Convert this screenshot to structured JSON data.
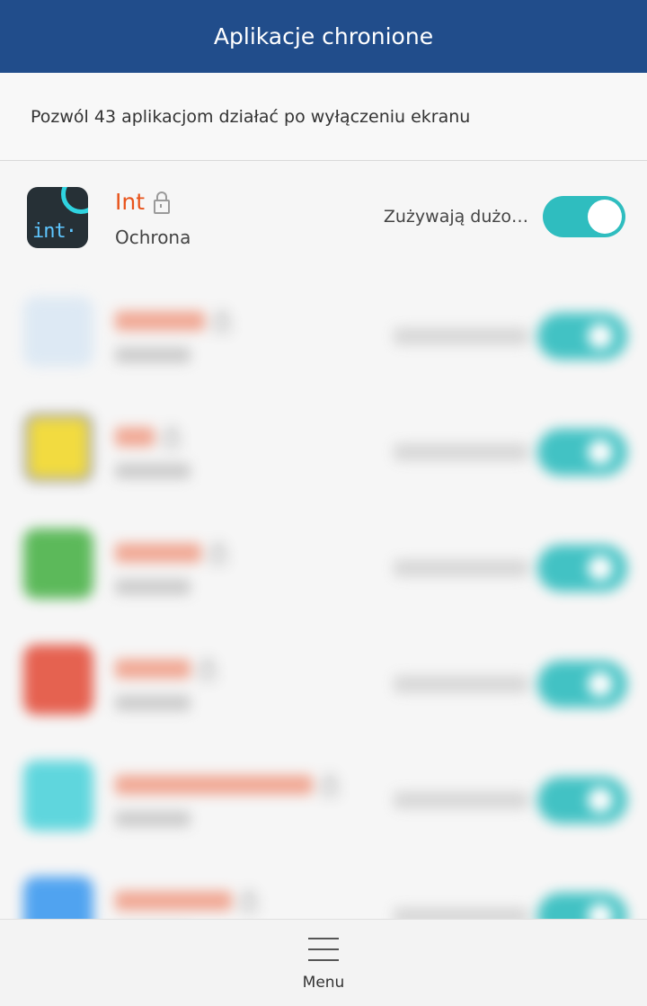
{
  "header": {
    "title": "Aplikacje chronione"
  },
  "subtitle": "Pozwól 43 aplikacjom działać po wyłączeniu ekranu",
  "apps": [
    {
      "name": "Int",
      "status": "Ochrona",
      "usage": "Zużywają dużo…",
      "enabled": true,
      "icon": "int-app-icon",
      "icon_color": "#263036"
    }
  ],
  "blurred_apps": [
    {
      "icon": "blurred-app-icon",
      "icon_color": "#dbe8f4",
      "enabled": true
    },
    {
      "icon": "blurred-app-icon",
      "icon_color": "#f2d92d",
      "enabled": true
    },
    {
      "icon": "blurred-app-icon",
      "icon_color": "#4cb34a",
      "enabled": true
    },
    {
      "icon": "blurred-app-icon",
      "icon_color": "#e4523f",
      "enabled": true
    },
    {
      "icon": "blurred-app-icon",
      "icon_color": "#4fd3db",
      "enabled": true
    },
    {
      "icon": "blurred-app-icon",
      "icon_color": "#3f9bf0",
      "enabled": true
    }
  ],
  "bottom_bar": {
    "menu_label": "Menu",
    "icon": "menu-icon"
  },
  "colors": {
    "header": "#214d8b",
    "accent_toggle": "#2fbdbf",
    "app_name": "#e8541c"
  }
}
